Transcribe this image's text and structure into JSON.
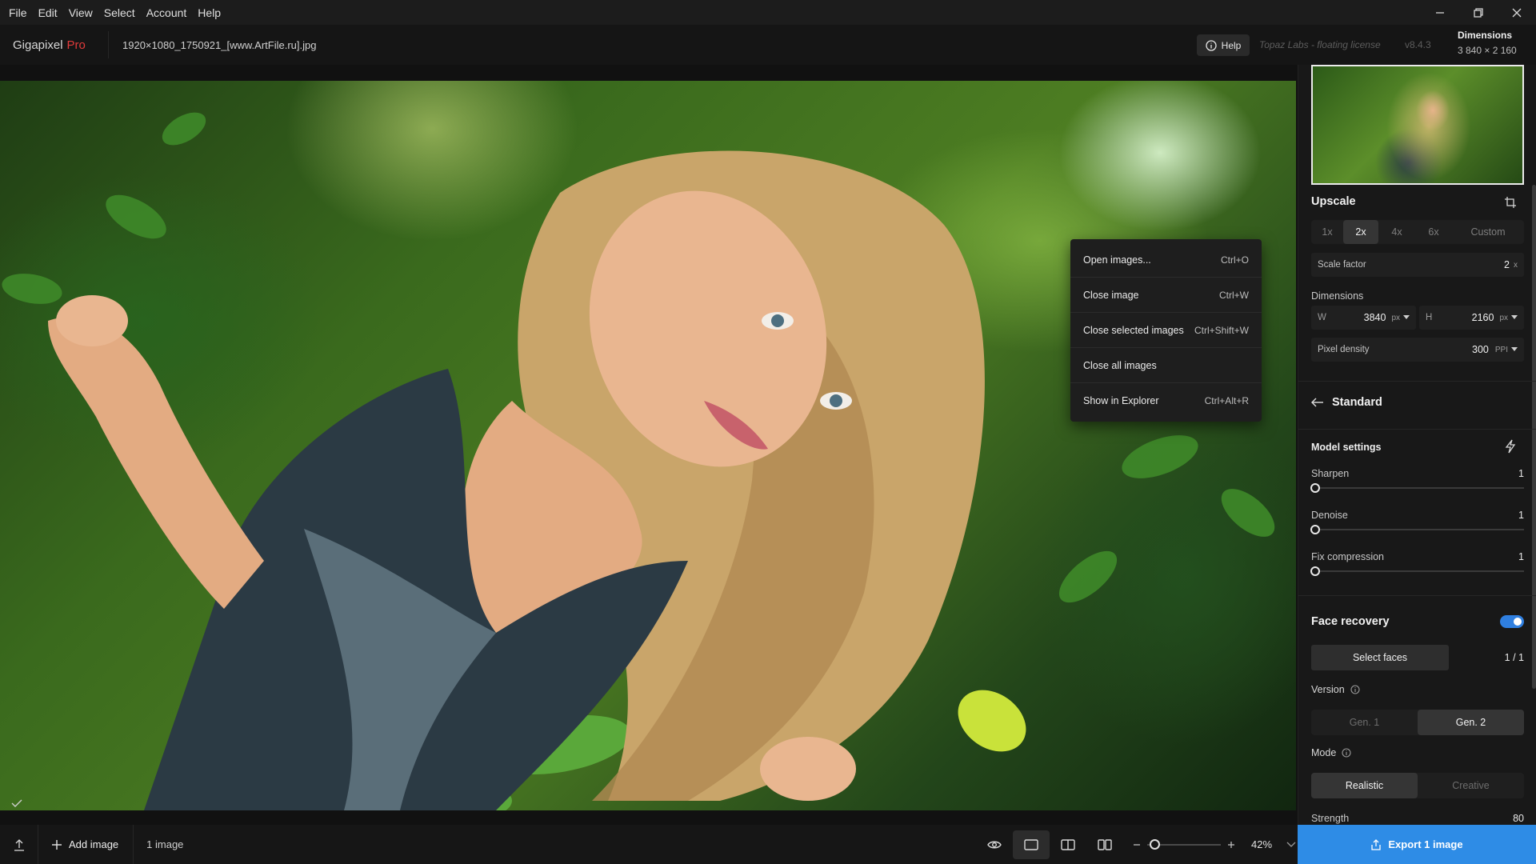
{
  "menubar": {
    "items": [
      "File",
      "Edit",
      "View",
      "Select",
      "Account",
      "Help"
    ]
  },
  "appbar": {
    "brand_name": "Gigapixel",
    "brand_tier": "Pro",
    "filename": "1920×1080_1750921_[www.ArtFile.ru].jpg",
    "help_label": "Help",
    "license": "Topaz Labs - floating license",
    "version": "v8.4.3",
    "dimensions_title": "Dimensions",
    "dimensions_value": "3 840 × 2 160"
  },
  "context_menu": {
    "items": [
      {
        "label": "Open images...",
        "shortcut": "Ctrl+O"
      },
      {
        "label": "Close image",
        "shortcut": "Ctrl+W"
      },
      {
        "label": "Close selected images",
        "shortcut": "Ctrl+Shift+W"
      },
      {
        "label": "Close all images",
        "shortcut": ""
      },
      {
        "label": "Show in Explorer",
        "shortcut": "Ctrl+Alt+R"
      }
    ]
  },
  "bottombar": {
    "add_image_label": "Add image",
    "image_count": "1 image",
    "zoom_value": "42%",
    "zoom_fraction": 0.1
  },
  "panel": {
    "upscale_title": "Upscale",
    "scale_tabs": [
      "1x",
      "2x",
      "4x",
      "6x",
      "Custom"
    ],
    "selected_scale": "2x",
    "scale_factor_label": "Scale factor",
    "scale_factor_value": "2",
    "scale_factor_unit": "x",
    "dimensions_label": "Dimensions",
    "width_label": "W",
    "width_value": "3840",
    "width_unit": "px",
    "height_label": "H",
    "height_value": "2160",
    "height_unit": "px",
    "pixel_density_label": "Pixel density",
    "pixel_density_value": "300",
    "pixel_density_unit": "PPI",
    "model_name": "Standard",
    "model_settings_title": "Model settings",
    "sliders": [
      {
        "label": "Sharpen",
        "value": "1"
      },
      {
        "label": "Denoise",
        "value": "1"
      },
      {
        "label": "Fix compression",
        "value": "1"
      }
    ],
    "face_recovery_title": "Face recovery",
    "face_recovery_enabled": true,
    "select_faces_label": "Select faces",
    "faces_count": "1 / 1",
    "version_label": "Version",
    "version_options": [
      "Gen. 1",
      "Gen. 2"
    ],
    "version_selected": "Gen. 2",
    "mode_label": "Mode",
    "mode_options": [
      "Realistic",
      "Creative"
    ],
    "mode_selected": "Realistic",
    "strength_label": "Strength",
    "strength_value": "80"
  },
  "export": {
    "label": "Export 1 image"
  },
  "colors": {
    "accent": "#2e8ce6",
    "brand_pro": "#e23b3b",
    "toggle_on": "#2f7fe0"
  }
}
